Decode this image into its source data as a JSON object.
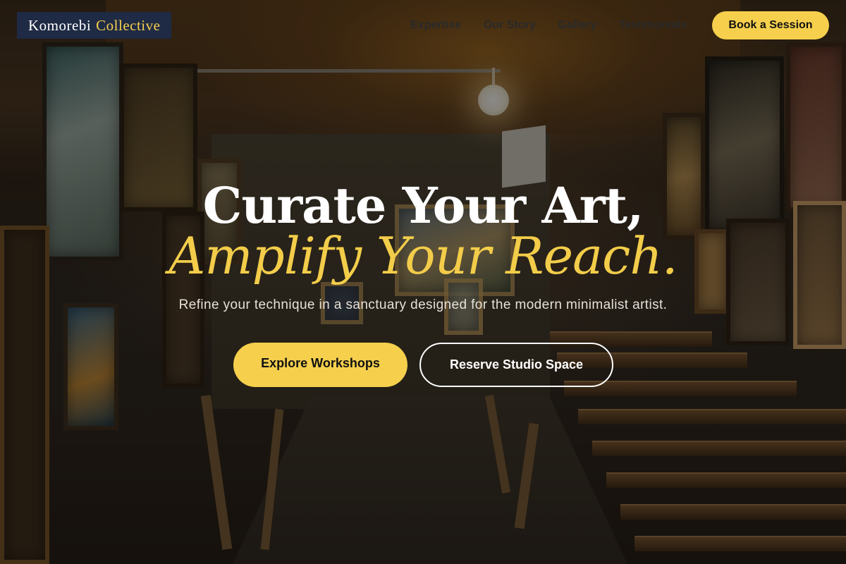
{
  "brand": {
    "name_part1": "Komorebi",
    "name_part2": "Collective"
  },
  "nav": {
    "items": [
      {
        "label": "Expertise"
      },
      {
        "label": "Our Story"
      },
      {
        "label": "Gallery"
      },
      {
        "label": "Testimonials"
      }
    ],
    "cta_label": "Book a Session"
  },
  "hero": {
    "headline_line1": "Curate Your Art,",
    "headline_line2": "Amplify Your Reach.",
    "subheadline": "Refine your technique in a sanctuary designed for the modern minimalist artist.",
    "primary_button": "Explore Workshops",
    "secondary_button": "Reserve Studio Space"
  },
  "colors": {
    "accent": "#f6d04d",
    "logo_background": "#1f2a44",
    "headline_white": "#ffffff",
    "headline_gold": "#f3cd4a"
  }
}
